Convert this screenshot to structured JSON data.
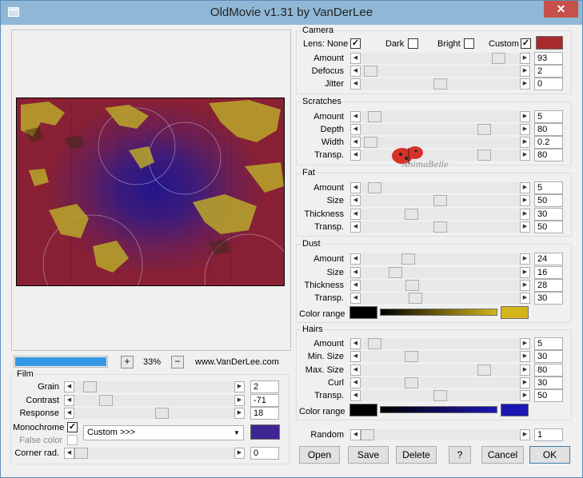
{
  "window": {
    "title": "OldMovie v1.31 by VanDerLee",
    "close_glyph": "✕"
  },
  "preview": {
    "zoom": "33%",
    "plus": "+",
    "minus": "−",
    "website": "www.VanDerLee.com",
    "progress_fraction": 0.98,
    "image_desc": "preview-image"
  },
  "film": {
    "caption": "Film",
    "rows": [
      {
        "label": "Grain",
        "value": "2",
        "fraction": 0.06
      },
      {
        "label": "Contrast",
        "value": "-71",
        "fraction": 0.17
      },
      {
        "label": "Response",
        "value": "18",
        "fraction": 0.55
      }
    ],
    "monochrome_label": "Monochrome",
    "monochrome": true,
    "false_color_label": "False color",
    "false_color": false,
    "preset": "Custom >>>",
    "mono_color": "#3f2594",
    "corner_label": "Corner rad.",
    "corner_value": "0",
    "corner_fraction": 0.0
  },
  "camera": {
    "caption": "Camera",
    "lens_label": "Lens: None",
    "lens": true,
    "dark_label": "Dark",
    "dark": false,
    "bright_label": "Bright",
    "bright": false,
    "custom_label": "Custom",
    "custom": true,
    "custom_color": "#a92a2a",
    "rows": [
      {
        "label": "Amount",
        "value": "93",
        "fraction": 0.9
      },
      {
        "label": "Defocus",
        "value": "2",
        "fraction": 0.02
      },
      {
        "label": "Jitter",
        "value": "0",
        "fraction": 0.5
      }
    ]
  },
  "scratches": {
    "caption": "Scratches",
    "rows": [
      {
        "label": "Amount",
        "value": "5",
        "fraction": 0.05
      },
      {
        "label": "Depth",
        "value": "80",
        "fraction": 0.8
      },
      {
        "label": "Width",
        "value": "0.2",
        "fraction": 0.02
      },
      {
        "label": "Transp.",
        "value": "80",
        "fraction": 0.8
      }
    ]
  },
  "watermark": "AnimaBelle",
  "fat": {
    "caption": "Fat",
    "rows": [
      {
        "label": "Amount",
        "value": "5",
        "fraction": 0.05
      },
      {
        "label": "Size",
        "value": "50",
        "fraction": 0.5
      },
      {
        "label": "Thickness",
        "value": "30",
        "fraction": 0.3
      },
      {
        "label": "Transp.",
        "value": "50",
        "fraction": 0.5
      }
    ]
  },
  "dust": {
    "caption": "Dust",
    "rows": [
      {
        "label": "Amount",
        "value": "24",
        "fraction": 0.28
      },
      {
        "label": "Size",
        "value": "16",
        "fraction": 0.19
      },
      {
        "label": "Thickness",
        "value": "28",
        "fraction": 0.31
      },
      {
        "label": "Transp.",
        "value": "30",
        "fraction": 0.33
      }
    ],
    "color_range_label": "Color range",
    "color_from": "#000000",
    "color_to": "#d4b51c"
  },
  "hairs": {
    "caption": "Hairs",
    "rows": [
      {
        "label": "Amount",
        "value": "5",
        "fraction": 0.05
      },
      {
        "label": "Min. Size",
        "value": "30",
        "fraction": 0.3
      },
      {
        "label": "Max. Size",
        "value": "80",
        "fraction": 0.8
      },
      {
        "label": "Curl",
        "value": "30",
        "fraction": 0.3
      },
      {
        "label": "Transp.",
        "value": "50",
        "fraction": 0.5
      }
    ],
    "color_range_label": "Color range",
    "color_from": "#000000",
    "color_to": "#1c17b4"
  },
  "random": {
    "label": "Random",
    "value": "1",
    "fraction": 0.0
  },
  "buttons": {
    "open": "Open",
    "save": "Save",
    "delete": "Delete",
    "help": "?",
    "cancel": "Cancel",
    "ok": "OK"
  }
}
